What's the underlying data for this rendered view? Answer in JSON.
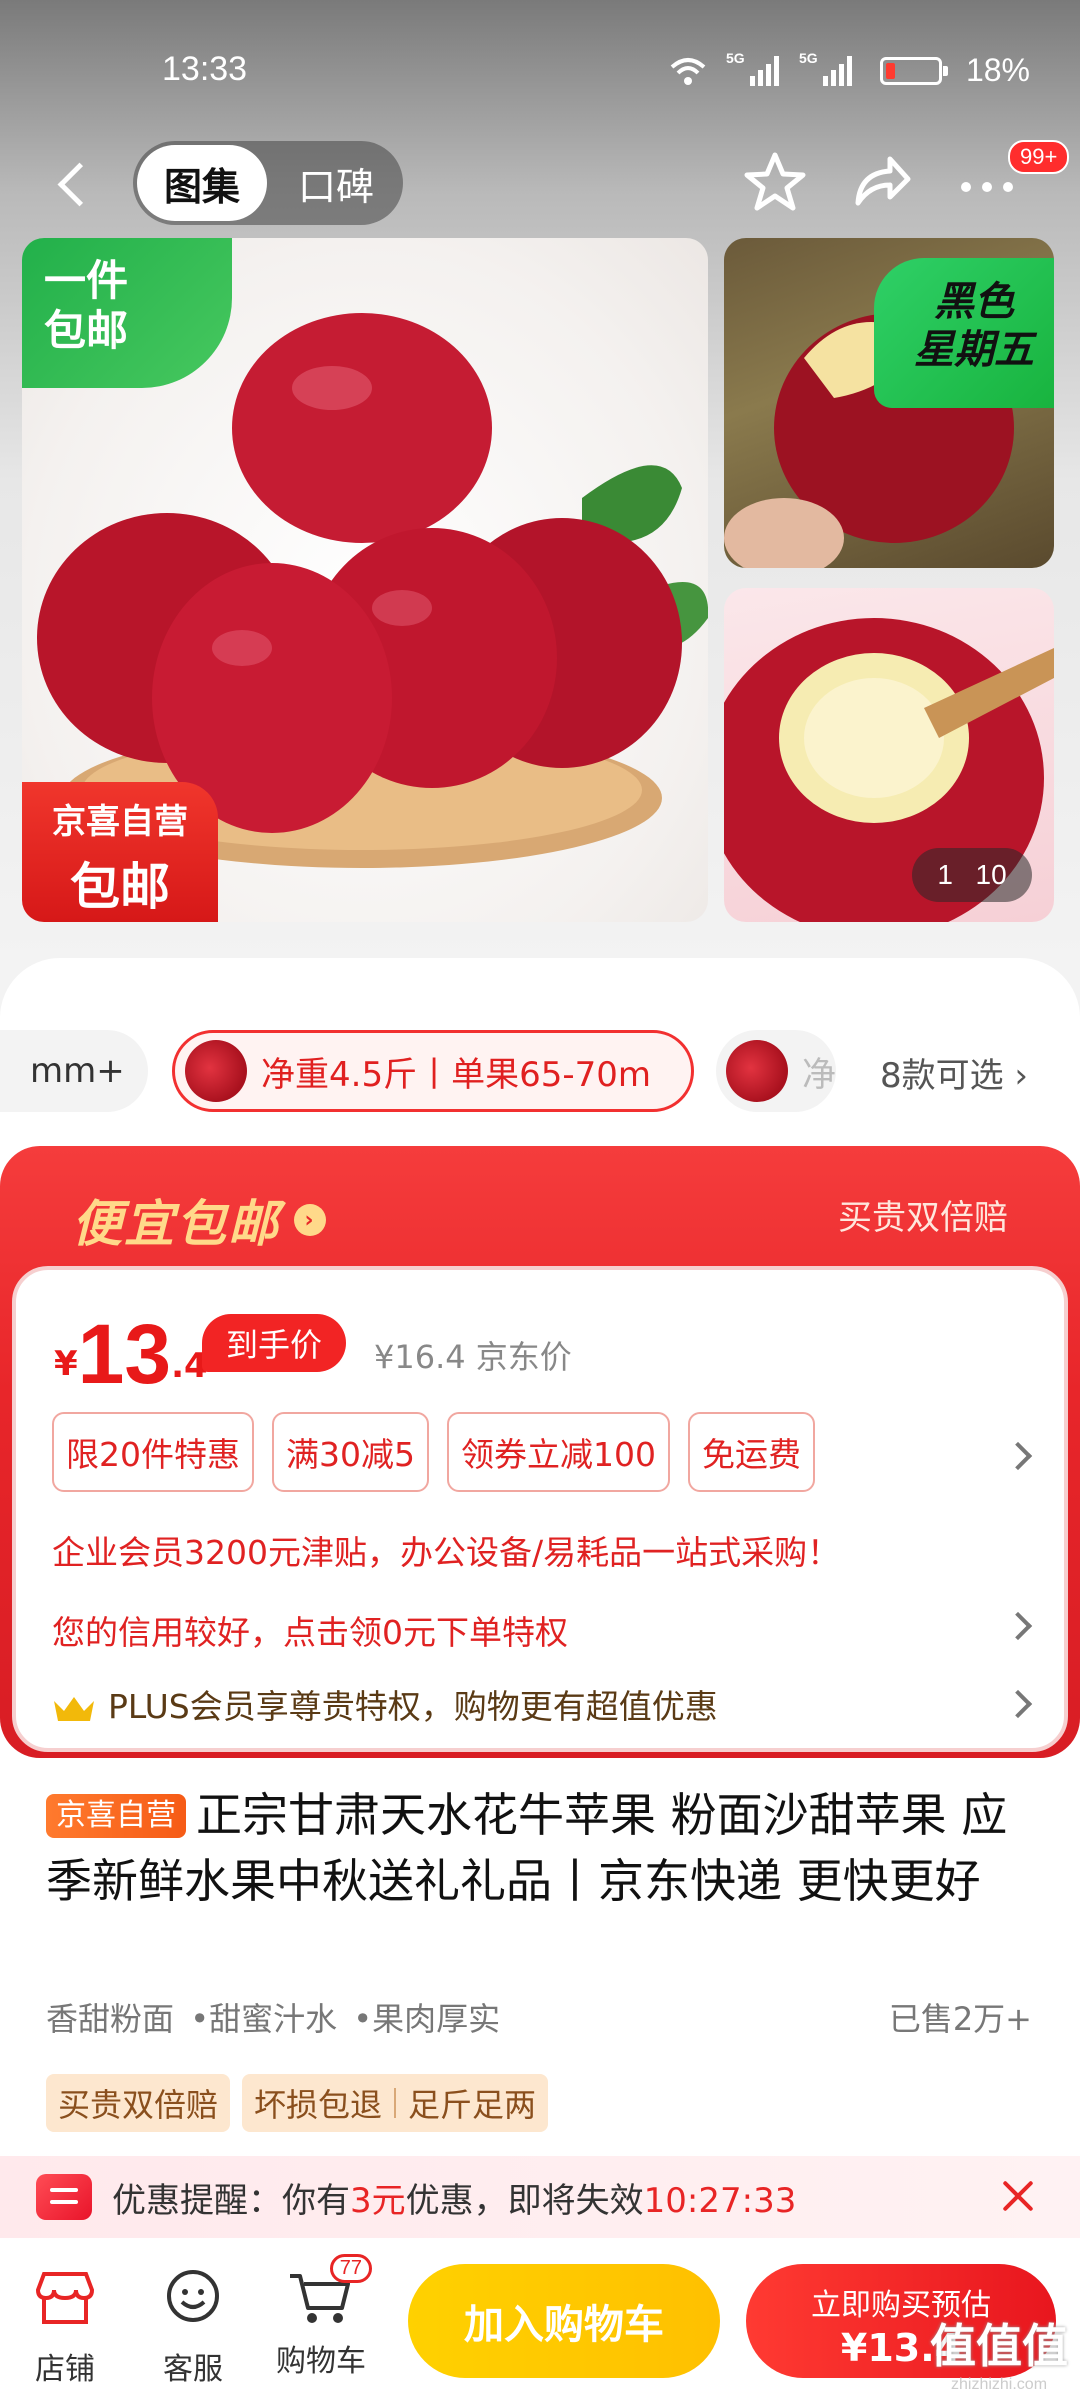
{
  "status_bar": {
    "time": "13:33",
    "network1": "5G",
    "network2": "5G",
    "battery": "18%",
    "battery_level": 0.18
  },
  "nav": {
    "tab_gallery": "图集",
    "tab_reviews": "口碑",
    "notif_badge": "99+"
  },
  "gallery": {
    "tag_free_ship_one": "一件\n包邮",
    "tag_jd_self": "京喜自营",
    "tag_free_ship": "包邮",
    "tag_black_friday": "黑色\n星期五",
    "counter_current": "1",
    "counter_total": "10"
  },
  "variants": {
    "left_partial": "mm+",
    "selected": "净重4.5斤丨单果65-70m",
    "right_partial": "净",
    "more": "8款可选"
  },
  "promo": {
    "title": "便宜包邮",
    "right_label": "买贵双倍赔",
    "price_yen": "¥",
    "price_int": "13",
    "price_dec": ".4",
    "price_tag": "到手价",
    "jd_price": "¥16.4 京东价",
    "chips": [
      "限20件特惠",
      "满30减5",
      "领券立减100",
      "免运费"
    ],
    "enterprise_line": "企业会员3200元津贴，办公设备/易耗品一站式采购！",
    "credit_line": "您的信用较好，点击领0元下单特权",
    "plus_line": "PLUS会员享尊贵特权，购物更有超值优惠"
  },
  "product": {
    "self_tag": "京喜自营",
    "title": "正宗甘肃天水花牛苹果 粉面沙甜苹果 应季新鲜水果中秋送礼礼品丨京东快递 更快更好",
    "features": [
      "香甜粉面",
      "•甜蜜汁水",
      "•果肉厚实"
    ],
    "sold": "已售2万+",
    "services": [
      "买贵双倍赔",
      "坏损包退",
      "足斤足两"
    ]
  },
  "reminder": {
    "prefix": "优惠提醒：你有",
    "amount": "3元",
    "suffix": "优惠，即将失效",
    "countdown": "10:27:33"
  },
  "bottom_bar": {
    "shop": "店铺",
    "service": "客服",
    "cart": "购物车",
    "cart_count": "77",
    "add_to_cart": "加入购物车",
    "buy_now": "立即购买预估",
    "buy_price": "¥13.4"
  },
  "watermark": {
    "text": "值值值",
    "url": "zhizhizhi.com"
  },
  "colors": {
    "accent_red": "#e82525",
    "cart_yellow": "#ffc800",
    "promo_gold": "#ffd98a"
  }
}
